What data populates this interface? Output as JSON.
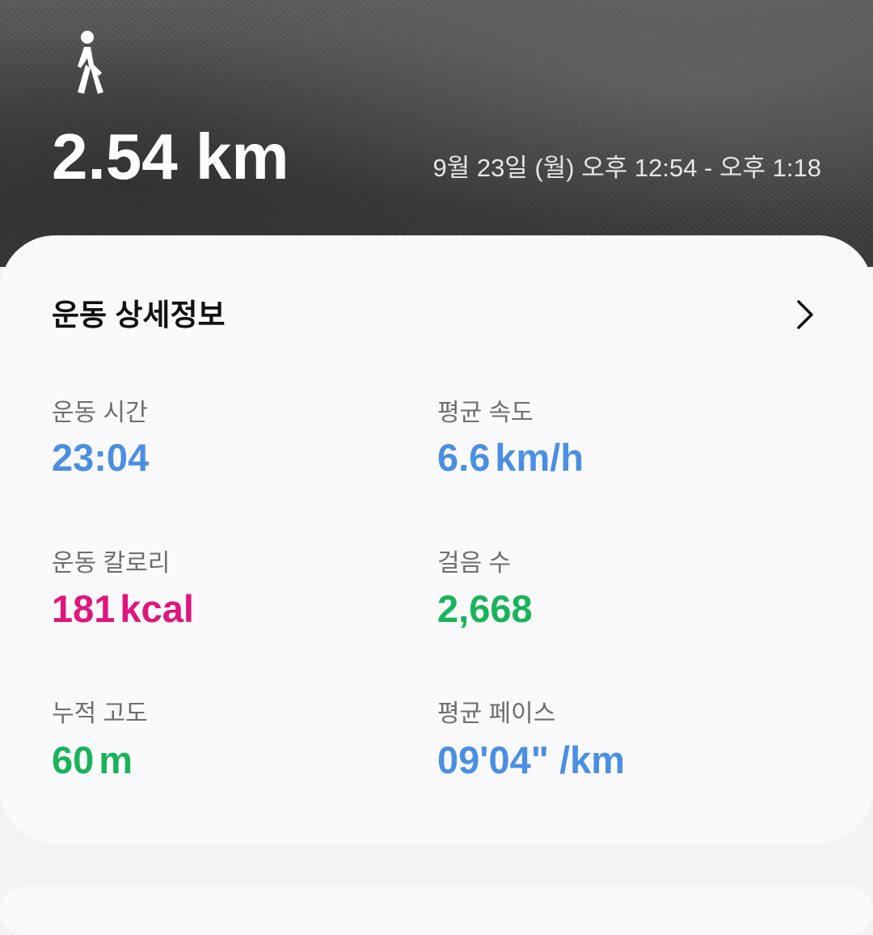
{
  "header": {
    "activity_icon": "walking-person-icon",
    "distance": "2.54 km",
    "datetime": "9월 23일 (월) 오후 12:54 - 오후 1:18"
  },
  "details": {
    "title": "운동 상세정보",
    "chevron_icon": "chevron-right-icon",
    "stats": {
      "duration": {
        "label": "운동 시간",
        "value": "23:04"
      },
      "avg_speed": {
        "label": "평균 속도",
        "value": "6.6",
        "unit": "km/h"
      },
      "calories": {
        "label": "운동 칼로리",
        "value": "181",
        "unit": "kcal"
      },
      "steps": {
        "label": "걸음 수",
        "value": "2,668"
      },
      "elevation": {
        "label": "누적 고도",
        "value": "60",
        "unit": "m"
      },
      "avg_pace": {
        "label": "평균 페이스",
        "value": "09'04\" /km"
      }
    }
  },
  "colors": {
    "blue": "#4a8fe2",
    "pink": "#e0157e",
    "green": "#19b45a"
  }
}
